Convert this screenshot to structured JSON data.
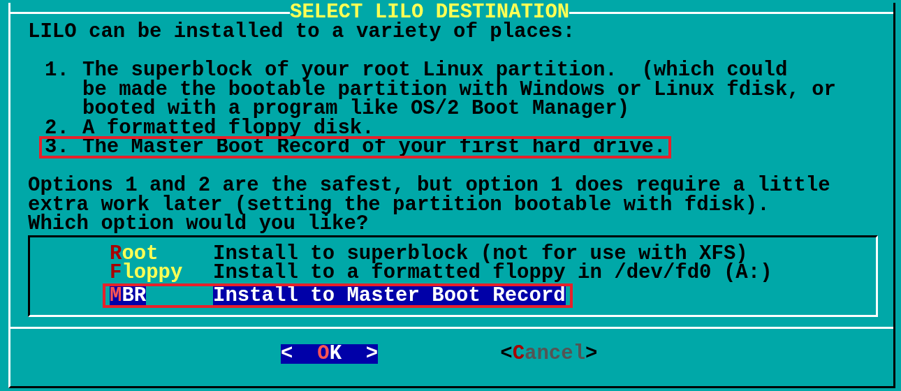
{
  "dialog": {
    "title": "SELECT LILO DESTINATION",
    "intro": "LILO can be installed to a variety of places:",
    "options": [
      {
        "number": "1.",
        "lines": [
          "The superblock of your root Linux partition.  (which could",
          "be made the bootable partition with Windows or Linux fdisk, or",
          "booted with a program like OS/2 Boot Manager)"
        ],
        "highlighted": false
      },
      {
        "number": "2.",
        "lines": [
          "A formatted floppy disk."
        ],
        "highlighted": false
      },
      {
        "number": "3.",
        "lines": [
          "The Master Boot Record of your first hard drive."
        ],
        "highlighted": true
      }
    ],
    "paragraph": [
      "Options 1 and 2 are the safest, but option 1 does require a little",
      "extra work later (setting the partition bootable with fdisk).",
      "Which option would you like?"
    ],
    "menu": [
      {
        "tag": "Root",
        "description": "Install to superblock (not for use with XFS)",
        "selected": false,
        "highlighted": false
      },
      {
        "tag": "Floppy",
        "description": "Install to a formatted floppy in /dev/fd0 (A:)",
        "selected": false,
        "highlighted": false
      },
      {
        "tag": "MBR",
        "description": "Install to Master Boot Record",
        "selected": true,
        "highlighted": true
      }
    ],
    "buttons": [
      {
        "label": "<  OK  >",
        "selected": true
      },
      {
        "label": "<Cancel>",
        "selected": false
      }
    ]
  }
}
